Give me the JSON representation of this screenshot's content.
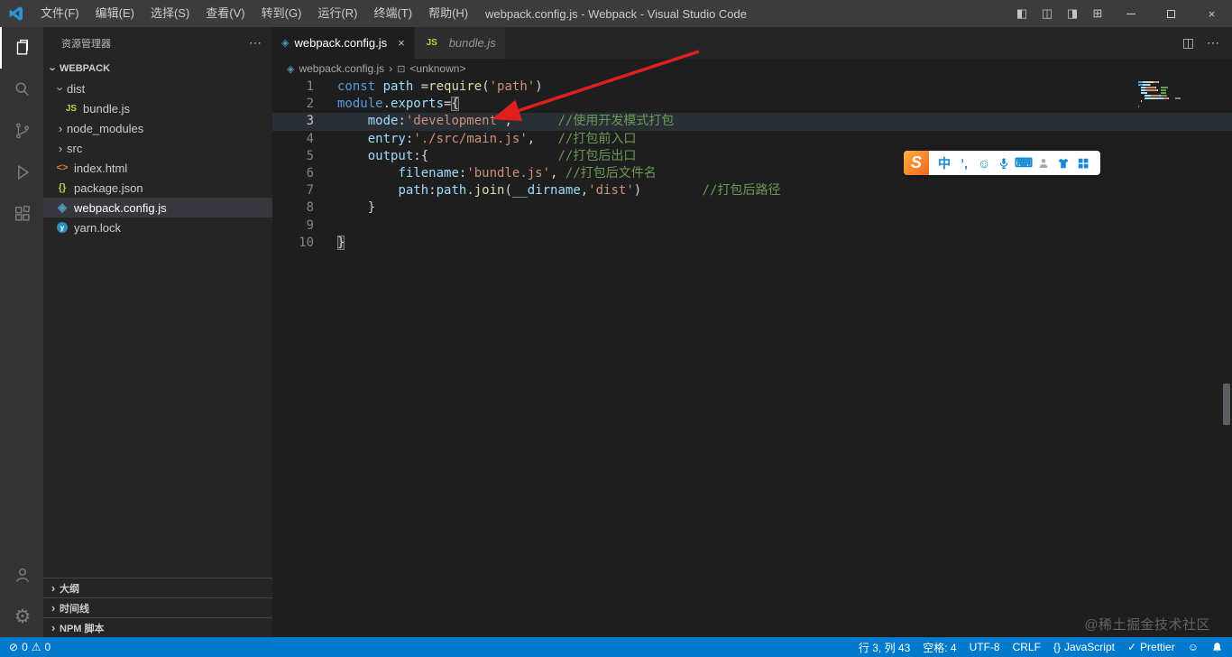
{
  "titlebar": {
    "menus": [
      "文件(F)",
      "编辑(E)",
      "选择(S)",
      "查看(V)",
      "转到(G)",
      "运行(R)",
      "终端(T)",
      "帮助(H)"
    ],
    "title": "webpack.config.js - Webpack - Visual Studio Code"
  },
  "icons": {
    "more": "⋯",
    "split": "◫",
    "close": "×",
    "chevron": "›",
    "webpack": "◈",
    "js": "JS",
    "html": "<>",
    "json": "{}",
    "yarn": "y",
    "symbol": "⊡",
    "sidebar_left": "◧",
    "panel": "◫",
    "sidebar_right": "◨",
    "layout": "⊞",
    "gear": "⚙",
    "error": "⊘",
    "warning": "⚠",
    "braces": "{}",
    "check": "✓",
    "feedback": "☺",
    "keyboard": "⌨",
    "emoji": "☺"
  },
  "explorer": {
    "panel_title": "资源管理器",
    "root": "WEBPACK",
    "items": [
      {
        "label": "dist",
        "kind": "folder-open"
      },
      {
        "label": "bundle.js",
        "kind": "js"
      },
      {
        "label": "node_modules",
        "kind": "folder"
      },
      {
        "label": "src",
        "kind": "folder"
      },
      {
        "label": "index.html",
        "kind": "html"
      },
      {
        "label": "package.json",
        "kind": "json"
      },
      {
        "label": "webpack.config.js",
        "kind": "webpack",
        "selected": true
      },
      {
        "label": "yarn.lock",
        "kind": "yarn"
      }
    ],
    "bottom_sections": [
      "大纲",
      "时间线",
      "NPM 脚本"
    ]
  },
  "tabs": [
    {
      "label": "webpack.config.js",
      "icon": "webpack",
      "active": true
    },
    {
      "label": "bundle.js",
      "icon": "js",
      "active": false
    }
  ],
  "breadcrumb": {
    "file": "webpack.config.js",
    "symbol": "<unknown>"
  },
  "code": {
    "lines": [
      {
        "num": "1",
        "tokens": [
          [
            "const ",
            "kw"
          ],
          [
            "path ",
            "vr"
          ],
          [
            "=",
            "pl"
          ],
          [
            "require",
            "fn"
          ],
          [
            "(",
            "pl"
          ],
          [
            "'path'",
            "st"
          ],
          [
            ")",
            "pl"
          ]
        ]
      },
      {
        "num": "2",
        "tokens": [
          [
            "module",
            "kw"
          ],
          [
            ".",
            "pl"
          ],
          [
            "exports",
            "vr"
          ],
          [
            "=",
            "pl"
          ],
          [
            "{",
            "bm"
          ]
        ]
      },
      {
        "num": "3",
        "current": true,
        "tokens": [
          [
            "    ",
            "pl"
          ],
          [
            "mode",
            "vr"
          ],
          [
            ":",
            "pl"
          ],
          [
            "'development'",
            "st"
          ],
          [
            ",",
            "pl"
          ],
          [
            "      ",
            "pl"
          ],
          [
            "//使用开发模式打包",
            "cm"
          ]
        ]
      },
      {
        "num": "4",
        "tokens": [
          [
            "    ",
            "pl"
          ],
          [
            "entry",
            "vr"
          ],
          [
            ":",
            "pl"
          ],
          [
            "'./src/main.js'",
            "st"
          ],
          [
            ",",
            "pl"
          ],
          [
            "   ",
            "pl"
          ],
          [
            "//打包前入口",
            "cm"
          ]
        ]
      },
      {
        "num": "5",
        "tokens": [
          [
            "    ",
            "pl"
          ],
          [
            "output",
            "vr"
          ],
          [
            ":",
            "pl"
          ],
          [
            "{",
            "pl"
          ],
          [
            "                 ",
            "pl"
          ],
          [
            "//打包后出口",
            "cm"
          ]
        ]
      },
      {
        "num": "6",
        "tokens": [
          [
            "        ",
            "pl"
          ],
          [
            "filename",
            "vr"
          ],
          [
            ":",
            "pl"
          ],
          [
            "'bundle.js'",
            "st"
          ],
          [
            ",",
            "pl"
          ],
          [
            " ",
            "pl"
          ],
          [
            "//打包后文件名",
            "cm"
          ]
        ]
      },
      {
        "num": "7",
        "tokens": [
          [
            "        ",
            "pl"
          ],
          [
            "path",
            "vr"
          ],
          [
            ":",
            "pl"
          ],
          [
            "path",
            "vr"
          ],
          [
            ".",
            "pl"
          ],
          [
            "join",
            "fn"
          ],
          [
            "(",
            "pl"
          ],
          [
            "__dirname",
            "vr"
          ],
          [
            ",",
            "pl"
          ],
          [
            "'dist'",
            "st"
          ],
          [
            ")",
            "pl"
          ],
          [
            "        ",
            "pl"
          ],
          [
            "//打包后路径",
            "cm"
          ]
        ]
      },
      {
        "num": "8",
        "tokens": [
          [
            "    ",
            "pl"
          ],
          [
            "}",
            "pl"
          ]
        ]
      },
      {
        "num": "9",
        "tokens": []
      },
      {
        "num": "10",
        "tokens": [
          [
            "}",
            "bm"
          ]
        ]
      }
    ]
  },
  "ime": {
    "logo": "S",
    "lang": "中",
    "punct": "’,"
  },
  "statusbar": {
    "errors": "0",
    "warnings": "0",
    "cursor": "行 3, 列 43",
    "indent": "空格: 4",
    "encoding": "UTF-8",
    "eol": "CRLF",
    "language": "JavaScript",
    "formatter": "Prettier"
  },
  "watermark": "@稀土掘金技术社区"
}
